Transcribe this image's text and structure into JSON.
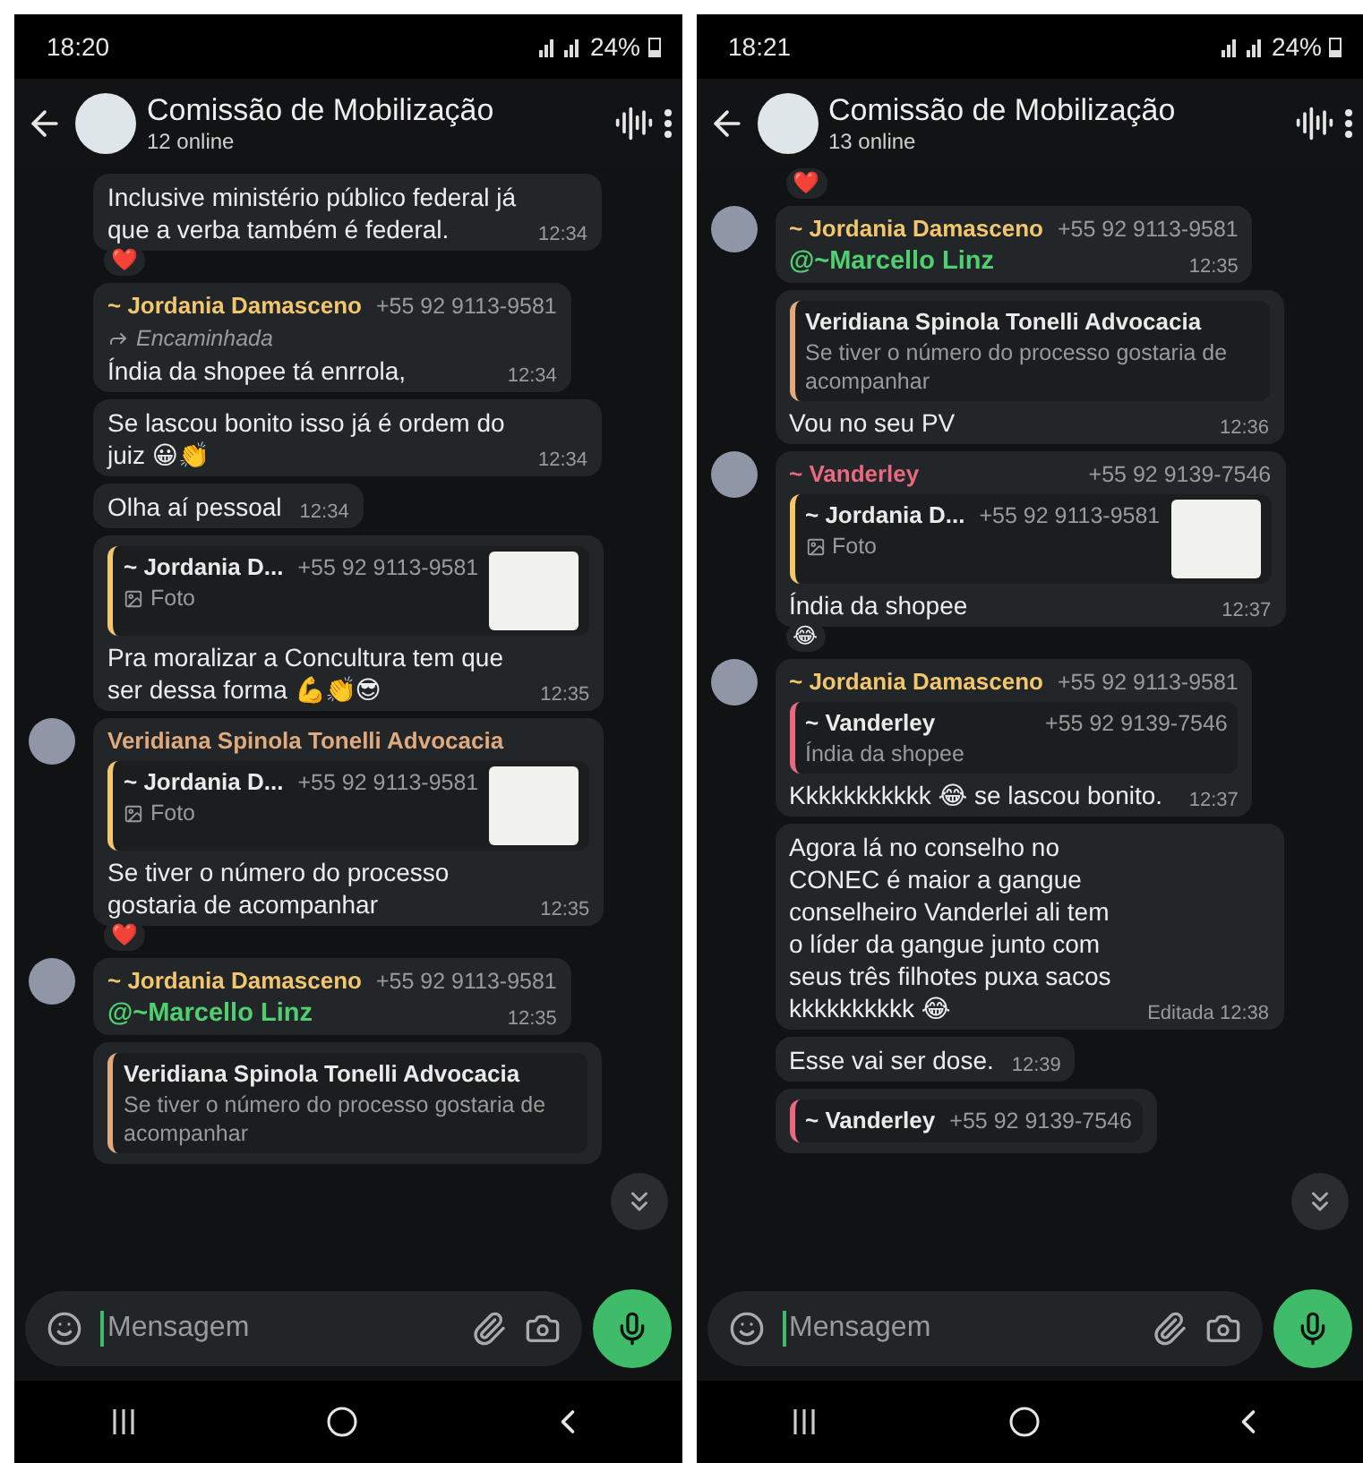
{
  "screens": [
    {
      "status": {
        "time": "18:20",
        "battery": "24%"
      },
      "header": {
        "title": "Comissão de Mobilização",
        "subtitle": "12 online"
      },
      "messages": [
        {
          "text": "Inclusive ministério público federal já que a verba também é federal.",
          "time": "12:34",
          "reaction": "❤️"
        },
        {
          "sender": "~ Jordania Damasceno",
          "phone": "+55 92 9113-9581",
          "color": "#f2c66d",
          "forwarded": "Encaminhada",
          "text": "Índia da shopee tá enrrola,",
          "time": "12:34"
        },
        {
          "text": "Se lascou bonito isso já é ordem do juiz 😀👏",
          "time": "12:34"
        },
        {
          "text": "Olha aí pessoal",
          "time": "12:34"
        },
        {
          "quote": {
            "sender": "~ Jordania D...",
            "phone": "+55 92 9113-9581",
            "color": "#f2c66d",
            "media": "Foto",
            "thumbnail": true
          },
          "text": "Pra moralizar a Concultura tem que ser dessa forma 💪👏😎",
          "time": "12:35"
        },
        {
          "avatar": true,
          "sender": "Veridiana Spinola Tonelli Advocacia",
          "color": "#e0a97e",
          "quote": {
            "sender": "~ Jordania D...",
            "phone": "+55 92 9113-9581",
            "color": "#f2c66d",
            "media": "Foto",
            "thumbnail": true
          },
          "text": "Se tiver o número do processo gostaria de acompanhar",
          "time": "12:35",
          "reaction": "❤️"
        },
        {
          "avatar": true,
          "sender": "~ Jordania Damasceno",
          "phone": "+55 92 9113-9581",
          "color": "#f2c66d",
          "mention": "@~Marcello Linz",
          "time": "12:35"
        },
        {
          "quote": {
            "sender": "Veridiana Spinola Tonelli Advocacia",
            "color": "#e0a97e",
            "text": "Se tiver o número do processo gostaria de acompanhar"
          }
        }
      ],
      "composer": {
        "placeholder": "Mensagem"
      }
    },
    {
      "status": {
        "time": "18:21",
        "battery": "24%"
      },
      "header": {
        "title": "Comissão de Mobilização",
        "subtitle": "13 online"
      },
      "messages": [
        {
          "reaction": "❤️"
        },
        {
          "avatar": true,
          "sender": "~ Jordania Damasceno",
          "phone": "+55 92 9113-9581",
          "color": "#f2c66d",
          "mention": "@~Marcello Linz",
          "time": "12:35"
        },
        {
          "quote": {
            "sender": "Veridiana Spinola Tonelli Advocacia",
            "color": "#e0a97e",
            "text": "Se tiver o número do processo gostaria de acompanhar"
          },
          "text": "Vou no seu PV",
          "time": "12:36"
        },
        {
          "avatar": true,
          "sender": "~ Vanderley",
          "phone": "+55 92 9139-7546",
          "color": "#e96a80",
          "quote": {
            "sender": "~ Jordania D...",
            "phone": "+55 92 9113-9581",
            "color": "#f2c66d",
            "media": "Foto",
            "thumbnail": true
          },
          "text": "Índia da shopee",
          "time": "12:37",
          "reaction": "😂"
        },
        {
          "avatar": true,
          "sender": "~ Jordania Damasceno",
          "phone": "+55 92 9113-9581",
          "color": "#f2c66d",
          "quote": {
            "sender": "~ Vanderley",
            "phone": "+55 92 9139-7546",
            "color": "#e96a80",
            "text": "Índia da shopee"
          },
          "text": "Kkkkkkkkkkk 😂 se lascou bonito.",
          "time": "12:37"
        },
        {
          "text": "Agora lá no conselho no CONEC é maior a gangue conselheiro Vanderlei ali tem o líder da gangue junto com seus três filhotes puxa sacos kkkkkkkkkk 😂",
          "edited": "Editada",
          "time": "12:38"
        },
        {
          "text": "Esse vai ser dose.",
          "time": "12:39"
        },
        {
          "quote": {
            "sender": "~ Vanderley",
            "phone": "+55 92 9139-7546",
            "color": "#e96a80"
          }
        }
      ],
      "composer": {
        "placeholder": "Mensagem"
      }
    }
  ]
}
